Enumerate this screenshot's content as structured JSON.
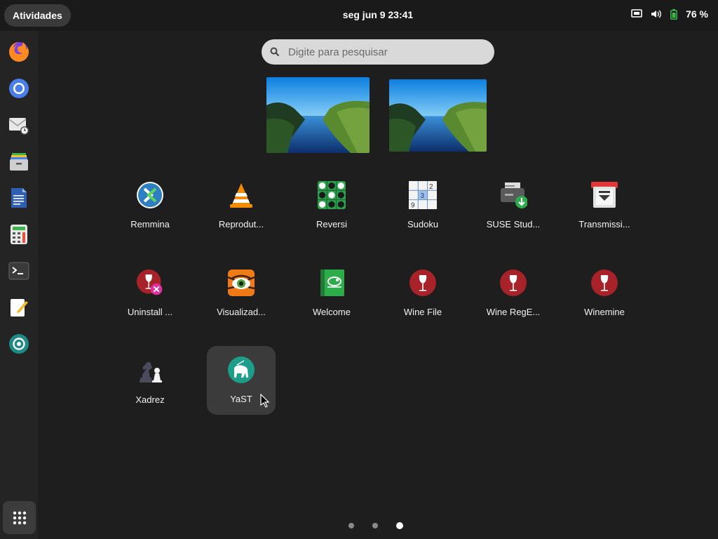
{
  "topbar": {
    "activities_label": "Atividades",
    "clock": "seg jun 9  23:41",
    "battery_percent": "76 %"
  },
  "search": {
    "placeholder": "Digite para pesquisar"
  },
  "dash": {
    "items": [
      "firefox-icon",
      "chromium-icon",
      "mail-icon",
      "file-archive-icon",
      "document-icon",
      "calculator-icon",
      "terminal-icon",
      "text-editor-icon",
      "camera-icon"
    ]
  },
  "apps": [
    {
      "label": "Remmina",
      "icon": "remmina-icon"
    },
    {
      "label": "Reprodut...",
      "icon": "vlc-icon"
    },
    {
      "label": "Reversi",
      "icon": "reversi-icon"
    },
    {
      "label": "Sudoku",
      "icon": "sudoku-icon"
    },
    {
      "label": "SUSE Stud...",
      "icon": "suse-studio-icon"
    },
    {
      "label": "Transmissi...",
      "icon": "transmission-icon"
    },
    {
      "label": "Uninstall ...",
      "icon": "wine-uninstall-icon"
    },
    {
      "label": "Visualizad...",
      "icon": "image-viewer-icon"
    },
    {
      "label": "Welcome",
      "icon": "opensuse-welcome-icon"
    },
    {
      "label": "Wine File",
      "icon": "wine-file-icon"
    },
    {
      "label": "Wine RegE...",
      "icon": "wine-regedit-icon"
    },
    {
      "label": "Winemine",
      "icon": "winemine-icon"
    },
    {
      "label": "Xadrez",
      "icon": "chess-icon"
    },
    {
      "label": "YaST",
      "icon": "yast-icon"
    }
  ],
  "sudoku_digits": [
    "2",
    "3",
    "9"
  ],
  "pages": {
    "count": 3,
    "active": 3
  },
  "colors": {
    "accent": "#ffffff",
    "panel": "#242424",
    "selected": "#3b3b3b"
  }
}
